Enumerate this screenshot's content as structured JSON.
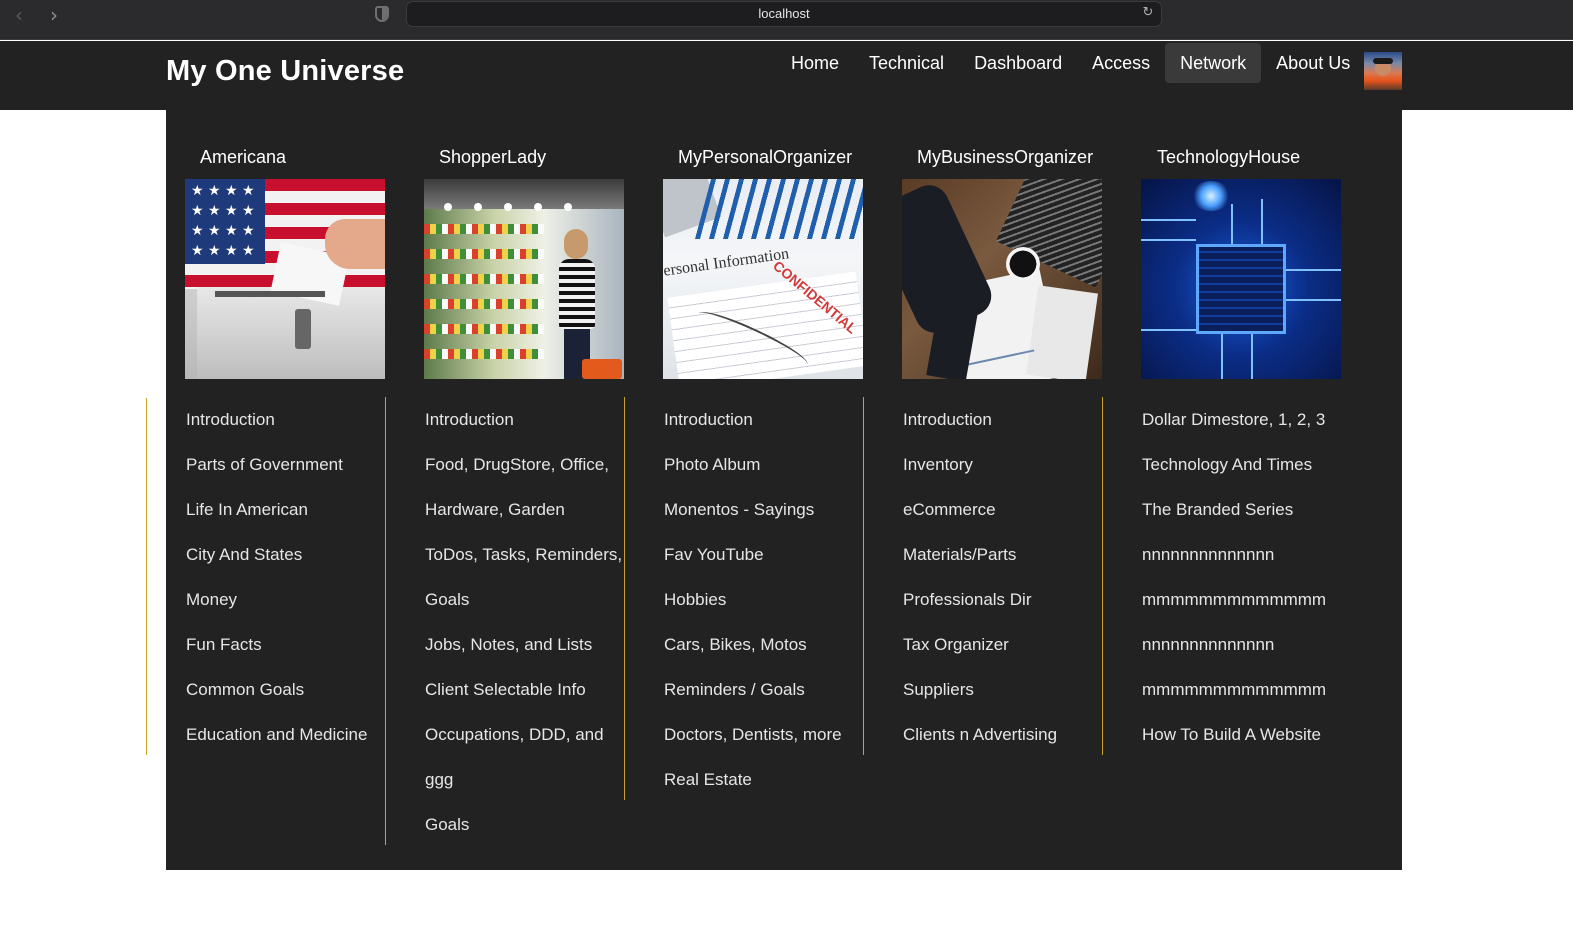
{
  "browser": {
    "url": "localhost"
  },
  "header": {
    "brand": "My One Universe",
    "nav": [
      {
        "label": "Home",
        "active": false
      },
      {
        "label": "Technical",
        "active": false
      },
      {
        "label": "Dashboard",
        "active": false
      },
      {
        "label": "Access",
        "active": false
      },
      {
        "label": "Network",
        "active": true
      },
      {
        "label": "About Us",
        "active": false
      }
    ]
  },
  "mega_menu": {
    "accent_color": "#c9a227",
    "columns": [
      {
        "title": "Americana",
        "image": "ballot-box-flag-image",
        "links": [
          "Introduction",
          "Parts of Government",
          "Life In American",
          "City And States",
          "Money",
          "Fun Facts",
          "Common Goals",
          "Education and Medicine"
        ]
      },
      {
        "title": "ShopperLady",
        "image": "grocery-shopper-image",
        "links": [
          "Introduction",
          "Food, DrugStore, Office,",
          "Hardware, Garden",
          "ToDos, Tasks, Reminders,",
          "Goals",
          "Jobs, Notes, and Lists",
          "Client Selectable Info",
          "Occupations, DDD, and",
          "ggg",
          "Goals"
        ]
      },
      {
        "title": "MyPersonalOrganizer",
        "image": "personal-information-form-image",
        "image_text": "ersonal Information",
        "image_stamp": "CONFIDENTIAL",
        "links": [
          "Introduction",
          "Photo Album",
          "Monentos - Sayings",
          "Fav YouTube",
          "Hobbies",
          "Cars, Bikes, Motos",
          "Reminders / Goals",
          "Doctors, Dentists, more",
          "Real Estate"
        ]
      },
      {
        "title": "MyBusinessOrganizer",
        "image": "business-desk-image",
        "links": [
          "Introduction",
          "Inventory",
          "eCommerce",
          "Materials/Parts",
          "Professionals Dir",
          "Tax Organizer",
          "Suppliers",
          "Clients n Advertising"
        ]
      },
      {
        "title": "TechnologyHouse",
        "image": "circuit-board-image",
        "links": [
          "Dollar Dimestore, 1, 2, 3",
          "Technology And Times",
          "The Branded Series",
          "nnnnnnnnnnnnnn",
          "mmmmmmmmmmmmm",
          "nnnnnnnnnnnnnn",
          "mmmmmmmmmmmmm",
          "How To Build A Website"
        ]
      }
    ]
  }
}
